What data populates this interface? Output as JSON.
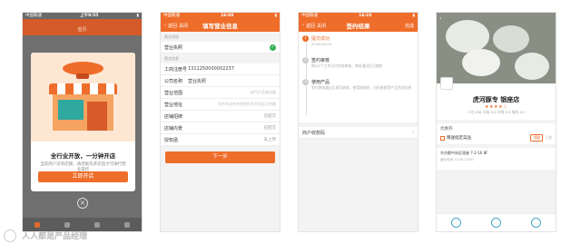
{
  "screen1": {
    "status_left": "中国联通",
    "status_time": "上午9:55",
    "status_right": "",
    "header": "首页",
    "modal_title": "全行业开放，一分钟开店",
    "modal_sub": "当前商户没有店铺，请老板先开店后才可进行营业操作",
    "modal_button": "立即开店",
    "tabs": [
      "",
      "",
      "",
      ""
    ]
  },
  "screen2": {
    "status_left": "中国联通",
    "status_time": "16:08",
    "status_right": "",
    "nav_back": "返回",
    "nav_close": "关闭",
    "title": "填写营业信息",
    "section1": "营业资质",
    "license_label": "营业执照",
    "section2": "营业信息",
    "reg_label": "工商注册号",
    "reg_value": "1311250000002237",
    "company_label": "公司名称",
    "company_value": "营业执照",
    "scope_label": "营业范围",
    "scope_value": "电气产品和设备",
    "addr_label": "营业地址",
    "addr_value": "北京市北京市经济技术开发区太合路",
    "sign_label": "店铺招牌",
    "sign_value": "已提交",
    "interior_label": "店铺内景",
    "interior_value": "已提交",
    "auth_label": "授权函",
    "auth_value": "未上传",
    "next_button": "下一步"
  },
  "screen3": {
    "status_left": "中国联通",
    "status_time": "16:10",
    "status_right": "",
    "nav_back": "返回",
    "nav_close": "关闭",
    "title": "签约结果",
    "nav_right": "完成",
    "steps": [
      {
        "num": "1",
        "name": "提交成功",
        "desc": "2016-08-09"
      },
      {
        "num": "2",
        "name": "签约审核",
        "desc": "预计1个工作日内完成审核，审核通过后可收款"
      },
      {
        "num": "3",
        "name": "使用产品",
        "desc": "签约审核通过后即可收款，使用收款码、扫码收款等产品完成交易"
      }
    ],
    "bind_label": "商户收款码"
  },
  "screen4": {
    "store_name": "虎河豚专 银座店",
    "stars": "★★★★☆",
    "meta": "人均 ¥98  口味 8.8  环境 8.9  服务 8.9",
    "promo_header": "优惠券",
    "promo_item": "赠送指定菜品",
    "promo_btn": "领取",
    "promo_sold": "已售",
    "address": "东京都中央区银座 7-2-16 8F",
    "address_sub": "营业时间 11:00-23:00",
    "colors": {
      "accent": "#ef6d2a",
      "link": "#4aa4c8"
    }
  },
  "watermark": "人人都是产品经理"
}
